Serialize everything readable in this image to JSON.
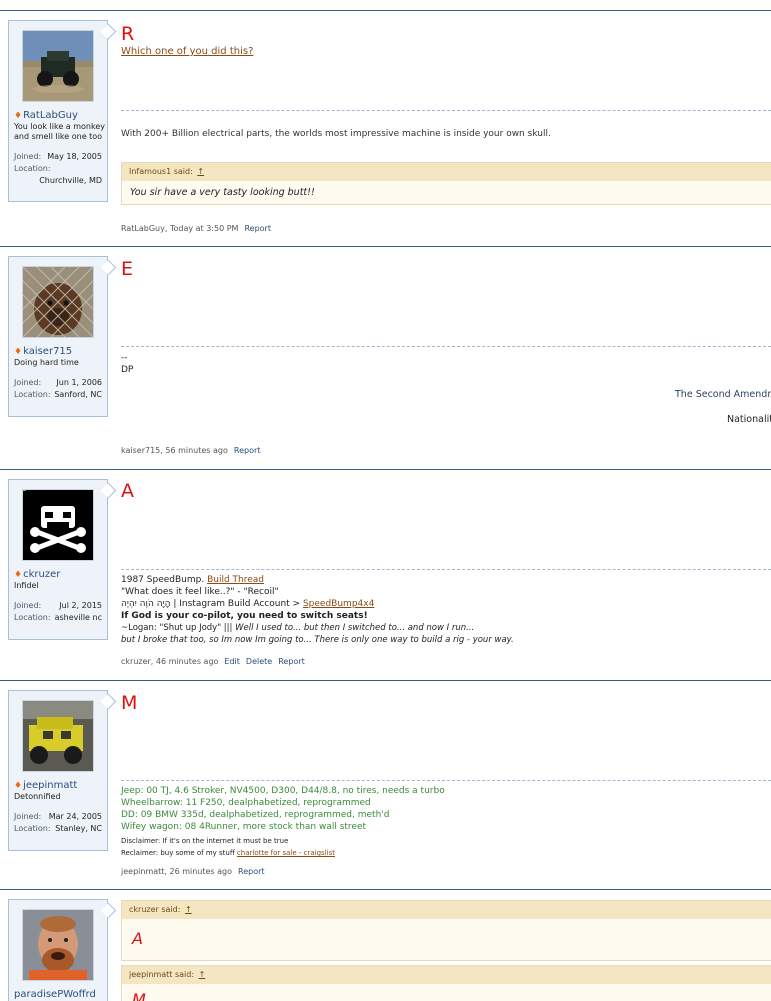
{
  "posts": [
    {
      "username": "RatLabGuy",
      "user_title": "You look like a monkey and smell like one too",
      "joined_label": "Joined:",
      "joined": "May 18, 2005",
      "location_label": "Location:",
      "location": "Churchville, MD",
      "message_letter": "R",
      "message_link": "Which one of you did this?",
      "signature": "With 200+ Billion electrical parts, the worlds most impressive machine is inside your own skull.",
      "quote_author": "Infamous1 said:",
      "quote_arrow": "↑",
      "quote_text": "You sir have a very tasty looking butt!!",
      "meta": "RatLabGuy, Today at 3:50 PM",
      "report": "Report"
    },
    {
      "username": "kaiser715",
      "user_title": "Doing hard time",
      "joined_label": "Joined:",
      "joined": "Jun 1, 2006",
      "location_label": "Location:",
      "location": "Sanford, NC",
      "message_letter": "E",
      "sig_dashes": "--",
      "sig_dp": "DP",
      "sig_second": "The Second Amendm",
      "sig_nat": "Nationalit",
      "meta": "kaiser715, 56 minutes ago",
      "report": "Report"
    },
    {
      "username": "ckruzer",
      "user_title": "Infidel",
      "joined_label": "Joined:",
      "joined": "Jul 2, 2015",
      "location_label": "Location:",
      "location": "asheville nc",
      "message_letter": "A",
      "sig_line1_prefix": "1987 SpeedBump. ",
      "sig_line1_link": "Build Thread",
      "sig_line2": "\"What does it feel like..?\" - \"Recoil\"",
      "sig_line3_prefix": "הָיָה הֹוֶה יִהְיֶה | Instagram Build Account > ",
      "sig_line3_link": "SpeedBump4x4",
      "sig_line4": "If God is your co-pilot, you need to switch seats!",
      "sig_line5_normal": "~Logan: \"Shut up Jody\" ||| ",
      "sig_line5_italic": "Well I used to... but then I switched to... and now I run...",
      "sig_line6": "but I broke that too, so Im now Im going to... There is only one way to build a rig - your way.",
      "meta": "ckruzer, 46 minutes ago",
      "edit": "Edit",
      "delete": "Delete",
      "report": "Report"
    },
    {
      "username": "jeepinmatt",
      "user_title": "Detonnified",
      "joined_label": "Joined:",
      "joined": "Mar 24, 2005",
      "location_label": "Location:",
      "location": "Stanley, NC",
      "message_letter": "M",
      "sig_line1": "Jeep: 00 TJ, 4.6 Stroker, NV4500, D300, D44/8.8, no tires, needs a turbo",
      "sig_line2": "Wheelbarrow: 11 F250, dealphabetized, reprogrammed",
      "sig_line3": "DD: 09 BMW 335d, dealphabetized, reprogrammed, meth'd",
      "sig_line4": "Wifey wagon: 08 4Runner, more stock than wall street",
      "sig_line5": "Disclaimer: If it's on the internet it must be true",
      "sig_line6_prefix": "Reclaimer: buy some of my stuff ",
      "sig_line6_link": "charlotte for sale - craigslist",
      "meta": "jeepinmatt, 26 minutes ago",
      "report": "Report"
    },
    {
      "username": "paradisePWoffrd",
      "quote1_author": "ckruzer said:",
      "quote1_arrow": "↑",
      "quote1_text": "A",
      "quote2_author": "jeepinmatt said:",
      "quote2_arrow": "↑",
      "quote2_text": "M"
    }
  ]
}
